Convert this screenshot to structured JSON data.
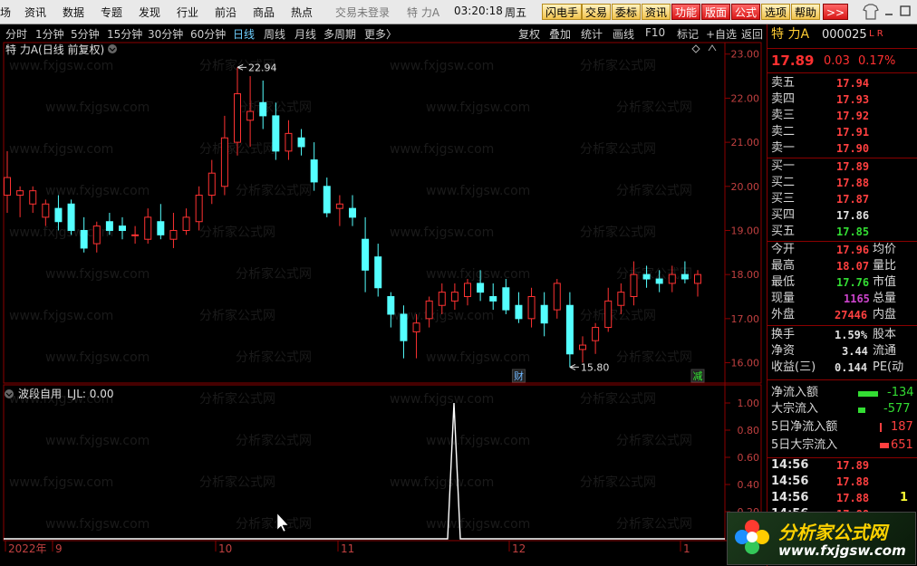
{
  "menubar": {
    "items": [
      "场",
      "资讯",
      "数据",
      "专题",
      "发现",
      "行业",
      "前沿",
      "商品",
      "热点"
    ],
    "login_text": "交易未登录",
    "stock_short": "特 力A",
    "time": "03:20:18",
    "weekday": "周五",
    "tools": [
      "闪电手",
      "交易",
      "委标",
      "资讯",
      "功能",
      "版面",
      "公式",
      "选项",
      "帮助",
      ">>"
    ]
  },
  "period_bar": {
    "periods": [
      "分时",
      "1分钟",
      "5分钟",
      "15分钟",
      "30分钟",
      "60分钟",
      "日线",
      "周线",
      "月线",
      "多周期",
      "更多〉"
    ],
    "active": "日线",
    "tools": [
      "复权",
      "叠加",
      "统计",
      "画线",
      "F10",
      "标记",
      "+自选",
      "返回"
    ]
  },
  "chart": {
    "title": "特 力A(日线 前复权)",
    "indicator_title": "波段自用",
    "indicator_value": "LJL: 0.00",
    "price_axis": [
      "23.00",
      "22.00",
      "21.00",
      "20.00",
      "19.00",
      "18.00",
      "17.00",
      "16.00"
    ],
    "indicator_axis": [
      "1.00",
      "0.80",
      "0.60",
      "0.40",
      "0.20"
    ],
    "max_label": "22.94",
    "min_label": "15.80",
    "markers": [
      {
        "text": "财",
        "color": "#6fb7ff",
        "index": 40
      },
      {
        "text": "榜",
        "color": "#ffcc33",
        "index": 55
      },
      {
        "text": "涨",
        "color": "#ff5555",
        "index": 61
      },
      {
        "text": "减",
        "color": "#33ee33",
        "index": 74
      }
    ],
    "date_labels": [
      {
        "text": "2022年",
        "index": 0
      },
      {
        "text": "9",
        "index": 6
      },
      {
        "text": "10",
        "index": 26
      },
      {
        "text": "11",
        "index": 41
      },
      {
        "text": "12",
        "index": 62
      },
      {
        "text": "1",
        "index": 83
      }
    ],
    "watermark": "www.fxjgsw.com",
    "watermark2": "分析家公式网"
  },
  "chart_data": {
    "type": "candlestick",
    "ylim": [
      15.6,
      23.2
    ],
    "series": [
      {
        "name": "特 力A",
        "ohlc": [
          [
            19.8,
            20.8,
            19.4,
            20.2
          ],
          [
            19.8,
            20.0,
            19.3,
            19.9
          ],
          [
            19.6,
            20.0,
            19.4,
            19.9
          ],
          [
            19.3,
            19.7,
            19.1,
            19.6
          ],
          [
            19.5,
            19.8,
            19.0,
            19.2
          ],
          [
            19.6,
            19.7,
            18.9,
            19.0
          ],
          [
            19.0,
            19.3,
            18.5,
            18.6
          ],
          [
            18.7,
            19.2,
            18.5,
            19.1
          ],
          [
            19.2,
            19.4,
            18.9,
            19.0
          ],
          [
            19.1,
            19.3,
            18.8,
            19.0
          ],
          [
            18.9,
            19.1,
            18.7,
            18.9
          ],
          [
            18.8,
            19.5,
            18.7,
            19.3
          ],
          [
            19.2,
            19.6,
            18.8,
            18.9
          ],
          [
            18.8,
            19.4,
            18.6,
            19.0
          ],
          [
            19.0,
            19.5,
            18.9,
            19.3
          ],
          [
            19.2,
            20.0,
            19.0,
            19.8
          ],
          [
            19.8,
            20.6,
            19.6,
            20.3
          ],
          [
            20.0,
            21.6,
            19.8,
            21.1
          ],
          [
            21.0,
            22.7,
            20.7,
            22.1
          ],
          [
            21.5,
            22.5,
            20.9,
            21.7
          ],
          [
            21.9,
            22.4,
            21.3,
            21.6
          ],
          [
            21.6,
            21.9,
            20.6,
            20.8
          ],
          [
            20.8,
            21.5,
            20.6,
            21.2
          ],
          [
            21.1,
            21.3,
            20.7,
            20.9
          ],
          [
            20.6,
            21.0,
            19.9,
            20.1
          ],
          [
            20.0,
            20.2,
            19.3,
            19.4
          ],
          [
            19.5,
            19.8,
            19.1,
            19.6
          ],
          [
            19.5,
            19.8,
            19.1,
            19.3
          ],
          [
            18.8,
            19.3,
            17.6,
            18.1
          ],
          [
            18.4,
            18.7,
            17.5,
            17.7
          ],
          [
            17.5,
            17.6,
            16.8,
            17.1
          ],
          [
            17.1,
            17.3,
            16.1,
            16.5
          ],
          [
            16.7,
            17.1,
            16.1,
            16.9
          ],
          [
            17.0,
            17.5,
            16.8,
            17.4
          ],
          [
            17.3,
            17.8,
            17.1,
            17.6
          ],
          [
            17.4,
            17.8,
            17.2,
            17.6
          ],
          [
            17.5,
            17.9,
            17.3,
            17.8
          ],
          [
            17.8,
            18.1,
            17.4,
            17.6
          ],
          [
            17.5,
            17.8,
            17.2,
            17.4
          ],
          [
            17.7,
            17.9,
            17.1,
            17.2
          ],
          [
            17.3,
            17.6,
            16.9,
            17.0
          ],
          [
            17.0,
            17.7,
            16.8,
            17.5
          ],
          [
            17.3,
            17.6,
            16.6,
            16.9
          ],
          [
            17.2,
            17.9,
            17.0,
            17.8
          ],
          [
            17.3,
            17.6,
            15.9,
            16.2
          ],
          [
            16.3,
            16.6,
            16.0,
            16.4
          ],
          [
            16.5,
            16.9,
            16.2,
            16.8
          ],
          [
            16.8,
            17.7,
            16.7,
            17.4
          ],
          [
            17.3,
            17.8,
            17.1,
            17.6
          ],
          [
            17.5,
            18.3,
            17.3,
            18.0
          ],
          [
            18.0,
            18.2,
            17.7,
            17.9
          ],
          [
            17.9,
            18.1,
            17.6,
            17.8
          ],
          [
            17.8,
            18.2,
            17.6,
            18.0
          ],
          [
            18.0,
            18.3,
            17.8,
            17.9
          ],
          [
            17.8,
            18.1,
            17.5,
            18.0
          ]
        ]
      }
    ]
  },
  "right_panel": {
    "stock_name": "特 力A",
    "code": "000025",
    "flags": "L R",
    "price": "17.89",
    "change": "0.03",
    "pct": "0.17%",
    "asks": [
      {
        "label": "卖五",
        "price": "17.94"
      },
      {
        "label": "卖四",
        "price": "17.93"
      },
      {
        "label": "卖三",
        "price": "17.92"
      },
      {
        "label": "卖二",
        "price": "17.91"
      },
      {
        "label": "卖一",
        "price": "17.90"
      }
    ],
    "bids": [
      {
        "label": "买一",
        "price": "17.89"
      },
      {
        "label": "买二",
        "price": "17.88"
      },
      {
        "label": "买三",
        "price": "17.87"
      },
      {
        "label": "买四",
        "price": "17.86"
      },
      {
        "label": "买五",
        "price": "17.85"
      }
    ],
    "stats": [
      {
        "label": "今开",
        "value": "17.96",
        "extra": "均价",
        "color": "#ff4040"
      },
      {
        "label": "最高",
        "value": "18.07",
        "extra": "量比",
        "color": "#ff4040"
      },
      {
        "label": "最低",
        "value": "17.76",
        "extra": "市值",
        "color": "#33dd33"
      },
      {
        "label": "现量",
        "value": "1165",
        "extra": "总量",
        "color": "#cc44cc"
      },
      {
        "label": "外盘",
        "value": "27446",
        "extra": "内盘",
        "color": "#ff4040"
      }
    ],
    "stats2": [
      {
        "label": "换手",
        "value": "1.59%",
        "extra": "股本"
      },
      {
        "label": "净资",
        "value": "3.44",
        "extra": "流通"
      },
      {
        "label": "收益(三)",
        "value": "0.144",
        "extra": "PE(动"
      }
    ],
    "flows": [
      {
        "label": "净流入额",
        "value": "-134",
        "color": "#33dd33"
      },
      {
        "label": "大宗流入",
        "value": "-577",
        "color": "#33dd33"
      },
      {
        "label": "5日净流入额",
        "value": "187",
        "color": "#ff4040"
      },
      {
        "label": "5日大宗流入",
        "value": "651",
        "color": "#ff4040"
      }
    ],
    "ticks": [
      {
        "time": "14:56",
        "price": "17.89",
        "vol": ""
      },
      {
        "time": "14:56",
        "price": "17.88",
        "vol": ""
      },
      {
        "time": "14:56",
        "price": "17.88",
        "vol": "1"
      },
      {
        "time": "14:56",
        "price": "17.88",
        "vol": ""
      }
    ],
    "logo_text": "分析家公式网",
    "logo_url": "www.fxjgsw.com"
  }
}
